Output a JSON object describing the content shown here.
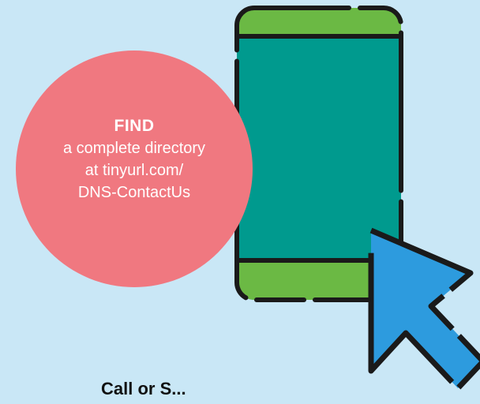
{
  "callout": {
    "heading": "FIND",
    "line1": "a complete directory",
    "line2": "at tinyurl.com/",
    "line3": "DNS-ContactUs"
  },
  "footer": {
    "text": "Call or S..."
  },
  "colors": {
    "background": "#c9e7f6",
    "circle": "#f07880",
    "phone_screen": "#009a8e",
    "phone_bars": "#6bb944",
    "cursor": "#2d9bde",
    "outline": "#1a1a1a"
  },
  "icons": [
    "smartphone-icon",
    "cursor-arrow-icon"
  ]
}
